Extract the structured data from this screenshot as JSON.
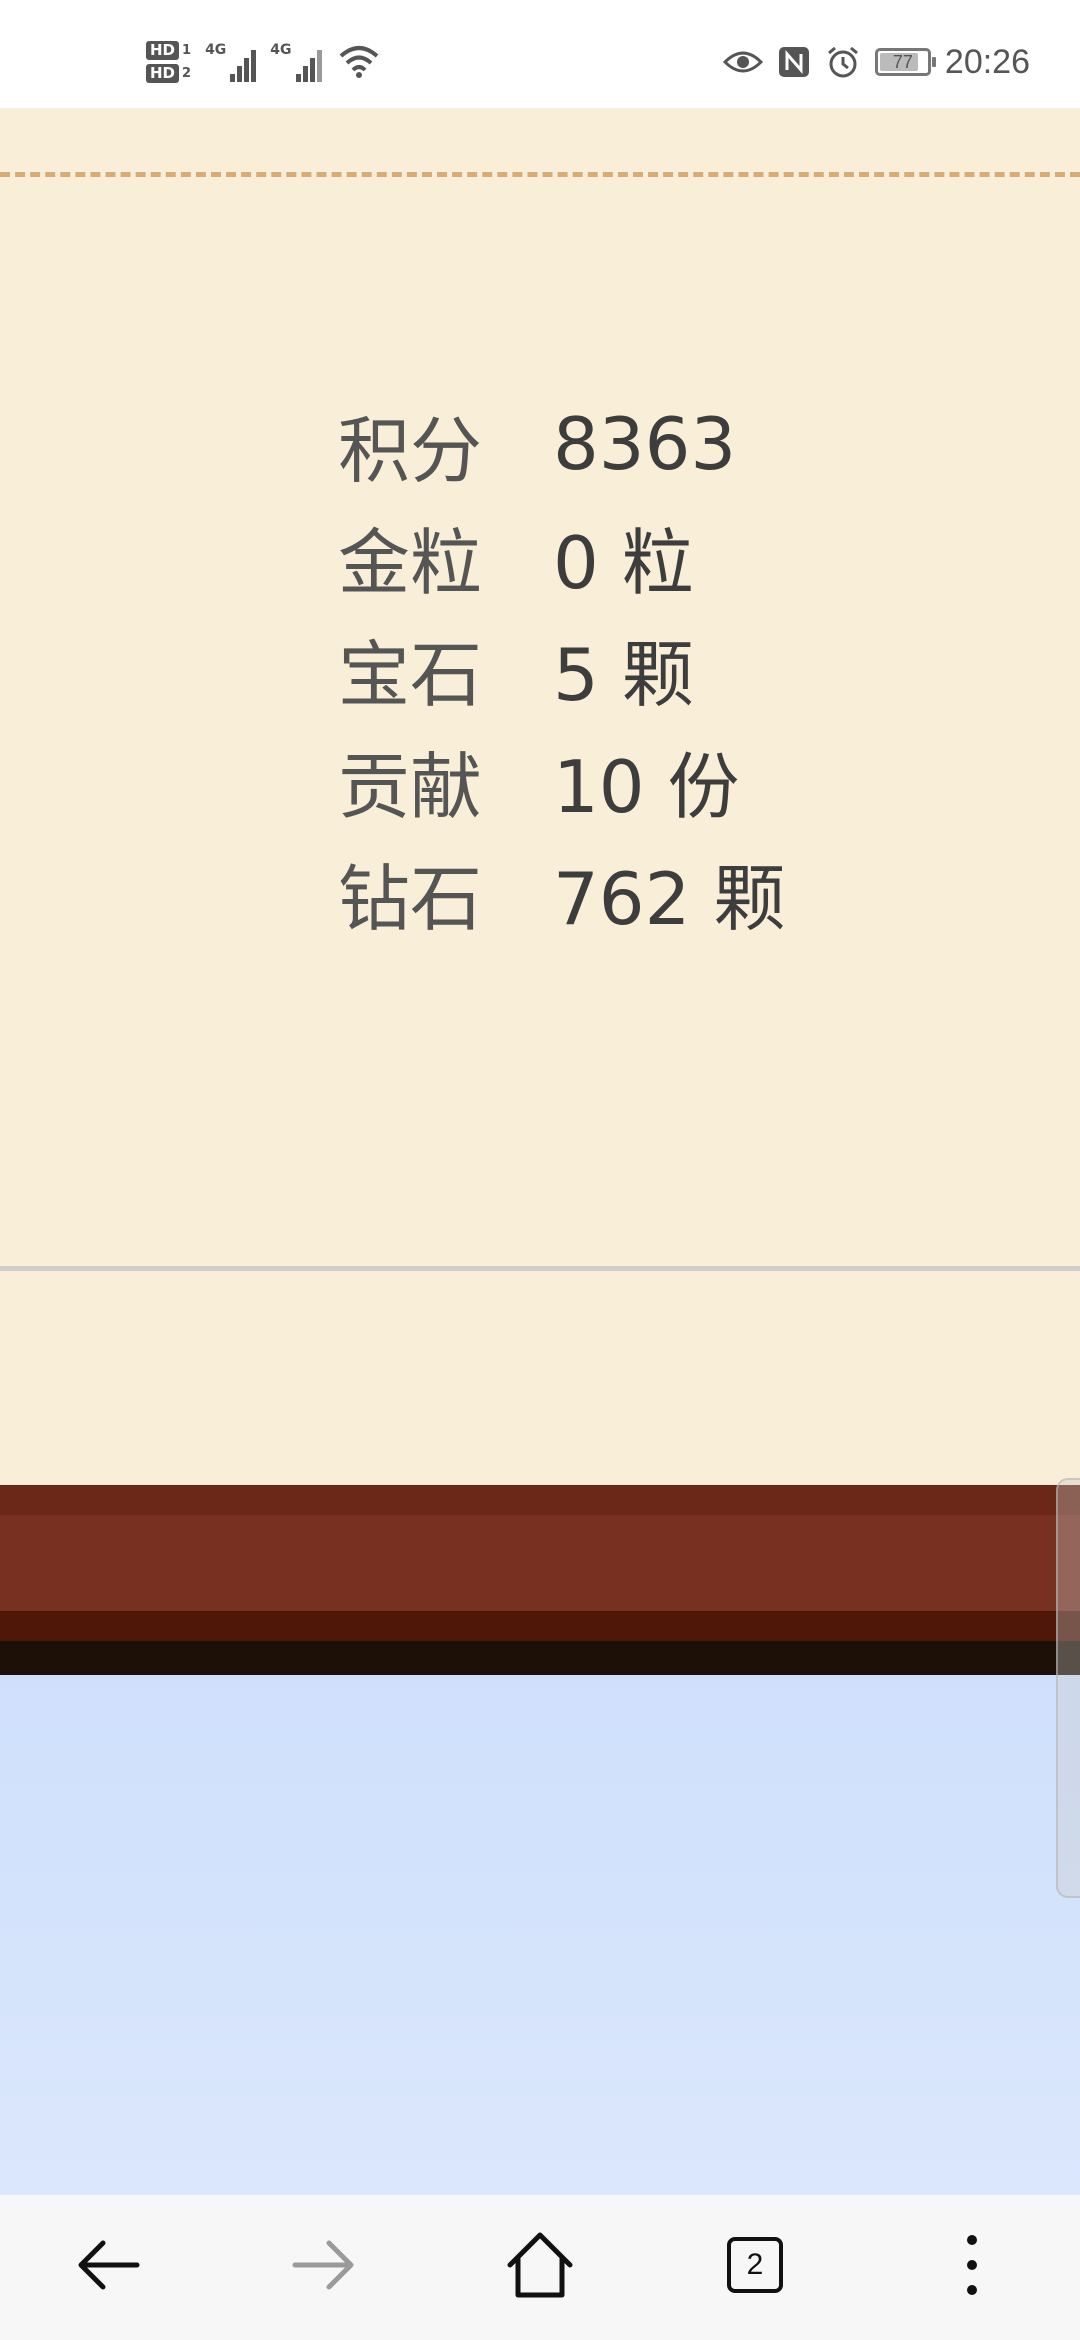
{
  "status_bar": {
    "time": "20:26",
    "battery_level": "77",
    "sim1_label": "HD",
    "sim1_index": "1",
    "sim2_label": "HD",
    "sim2_index": "2",
    "network_1": "4G",
    "network_2": "4G",
    "icons": [
      "eye-comfort-icon",
      "nfc-icon",
      "alarm-icon",
      "battery-icon",
      "wifi-icon"
    ]
  },
  "stats": [
    {
      "label": "积分",
      "value": "8363"
    },
    {
      "label": "金粒",
      "value": "0 粒"
    },
    {
      "label": "宝石",
      "value": "5 颗"
    },
    {
      "label": "贡献",
      "value": "10 份"
    },
    {
      "label": "钻石",
      "value": "762 颗"
    }
  ],
  "toolbar": {
    "tab_count": "2",
    "icons": [
      "back-arrow-icon",
      "forward-arrow-icon",
      "home-icon",
      "tabs-icon",
      "more-icon"
    ]
  },
  "colors": {
    "cream": "#f9efd9",
    "dash": "#d9ac76",
    "wood": "#783120",
    "blue": "#d6e4fb"
  }
}
